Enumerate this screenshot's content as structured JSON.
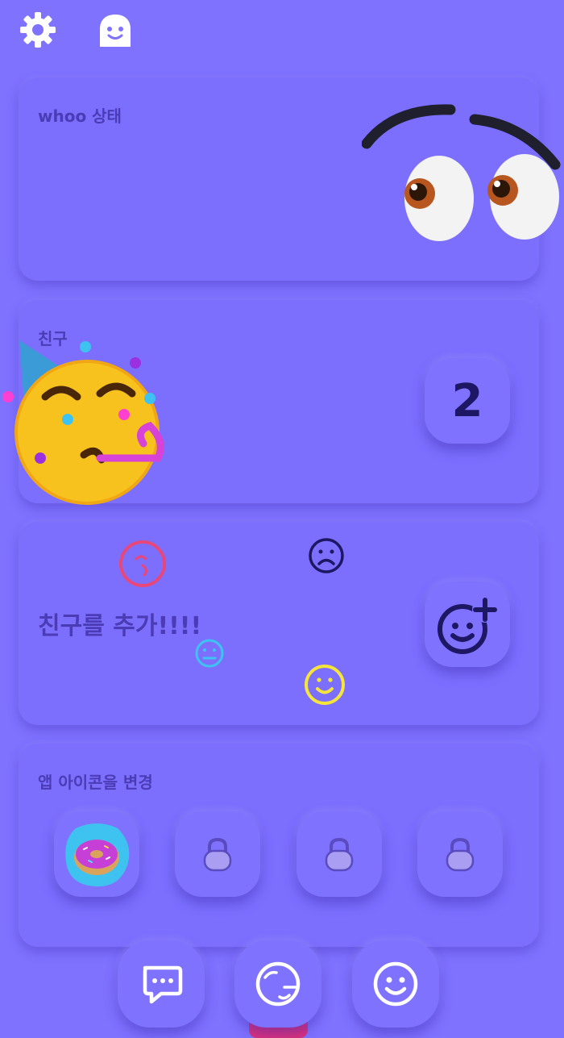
{
  "topbar": {
    "settings_icon": "gear-icon",
    "profile_icon": "ghost-icon"
  },
  "status_card": {
    "title": "whoo 상태"
  },
  "friends_card": {
    "title": "친구",
    "count": "2"
  },
  "add_friend_card": {
    "label": "친구를 추가!!!!"
  },
  "app_icon_card": {
    "title": "앱 아이콘을 변경",
    "icons": [
      {
        "name": "donut",
        "locked": false
      },
      {
        "name": "locked-1",
        "locked": true
      },
      {
        "name": "locked-2",
        "locked": true
      },
      {
        "name": "locked-3",
        "locked": true
      }
    ]
  },
  "bottom_nav": {
    "items": [
      "chat-icon",
      "globe-icon",
      "smiley-icon"
    ]
  },
  "colors": {
    "background": "#7f72ff",
    "card": "#7c6ffe",
    "title_text": "#4b3cb5",
    "count_text": "#1e1764",
    "nav_indicator": "#e0307a"
  }
}
